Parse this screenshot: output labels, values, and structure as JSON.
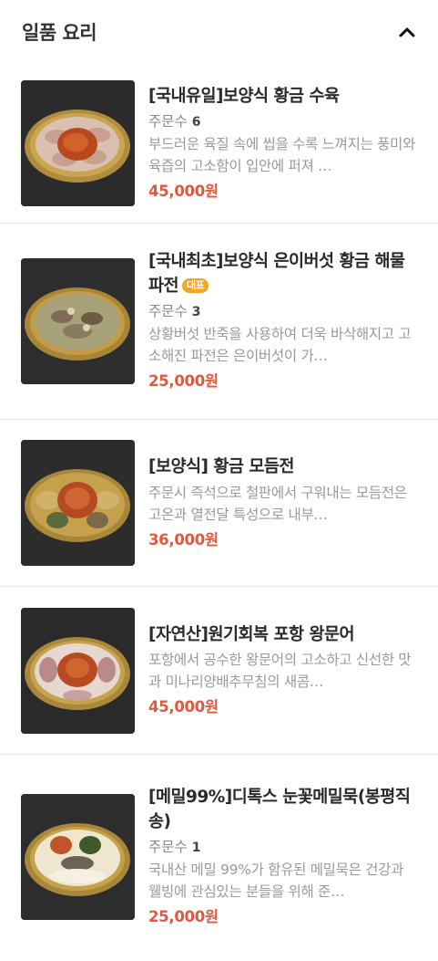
{
  "section": {
    "title": "일품 요리",
    "toggle_icon": "chevron-up-icon"
  },
  "items": [
    {
      "name": "[국내유일]보양식 황금 수육",
      "badge": "",
      "orders_label": "주문수",
      "orders": "6",
      "desc": "부드러운 육질 속에 씹을 수록 느껴지는 풍미와 육즙의 고소함이 입안에 퍼져 …",
      "price": "45,000원",
      "image": "boiled-pork-platter"
    },
    {
      "name": "[국내최초]보양식 은이버섯 황금 해물파전",
      "badge": "대표",
      "orders_label": "주문수",
      "orders": "3",
      "desc": "상황버섯 반죽을 사용하여 더욱 바삭해지고 고소해진 파전은 은이버섯이 가…",
      "price": "25,000원",
      "image": "seafood-pancake-platter"
    },
    {
      "name": "[보양식] 황금 모듬전",
      "badge": "",
      "orders_label": "",
      "orders": "",
      "desc": "주문시 즉석으로 철판에서 구워내는 모듬전은 고온과 열전달 특성으로 내부…",
      "price": "36,000원",
      "image": "assorted-jeon-platter"
    },
    {
      "name": "[자연산]원기회복 포항 왕문어",
      "badge": "",
      "orders_label": "",
      "orders": "",
      "desc": "포항에서 공수한 왕문어의 고소하고 신선한 맛과 미나리양배추무침의 새콤…",
      "price": "45,000원",
      "image": "octopus-platter"
    },
    {
      "name": "[메밀99%]디톡스 눈꽃메밀묵(봉평직송)",
      "badge": "",
      "orders_label": "주문수",
      "orders": "1",
      "desc": "국내산 메밀 99%가 함유된 메밀묵은 건강과 웰빙에 관심있는 분들을 위해 준…",
      "price": "25,000원",
      "image": "buckwheat-jelly-platter"
    }
  ]
}
